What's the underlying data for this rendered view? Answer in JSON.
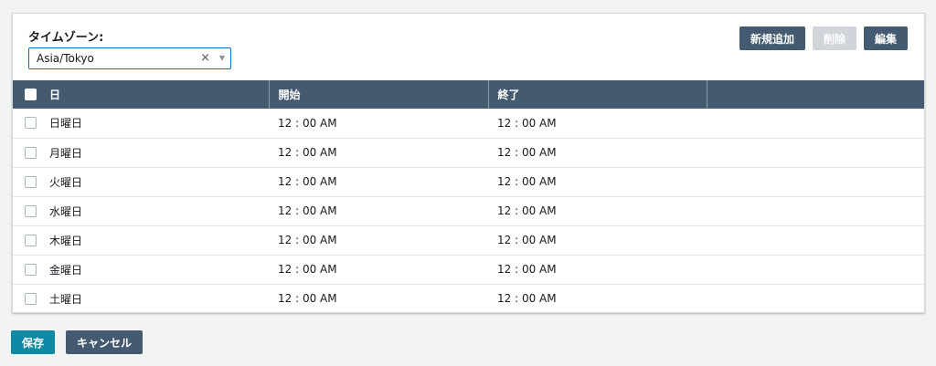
{
  "timezone": {
    "label": "タイムゾーン:",
    "value": "Asia/Tokyo",
    "clear": "×",
    "caret": "▼"
  },
  "toolbar": {
    "add_label": "新規追加",
    "delete_label": "削除",
    "edit_label": "編集"
  },
  "table": {
    "headers": [
      "日",
      "開始",
      "終了",
      ""
    ],
    "rows": [
      {
        "day": "日曜日",
        "start": "12 : 00 AM",
        "end": "12 : 00 AM"
      },
      {
        "day": "月曜日",
        "start": "12 : 00 AM",
        "end": "12 : 00 AM"
      },
      {
        "day": "火曜日",
        "start": "12 : 00 AM",
        "end": "12 : 00 AM"
      },
      {
        "day": "水曜日",
        "start": "12 : 00 AM",
        "end": "12 : 00 AM"
      },
      {
        "day": "木曜日",
        "start": "12 : 00 AM",
        "end": "12 : 00 AM"
      },
      {
        "day": "金曜日",
        "start": "12 : 00 AM",
        "end": "12 : 00 AM"
      },
      {
        "day": "土曜日",
        "start": "12 : 00 AM",
        "end": "12 : 00 AM"
      }
    ]
  },
  "footer": {
    "save_label": "保存",
    "cancel_label": "キャンセル"
  },
  "colors": {
    "header_bg": "#445a70",
    "primary_button": "#0f8aa6",
    "secondary_button": "#445a70",
    "disabled_button": "#d0d5db",
    "select_border": "#0073bb"
  }
}
